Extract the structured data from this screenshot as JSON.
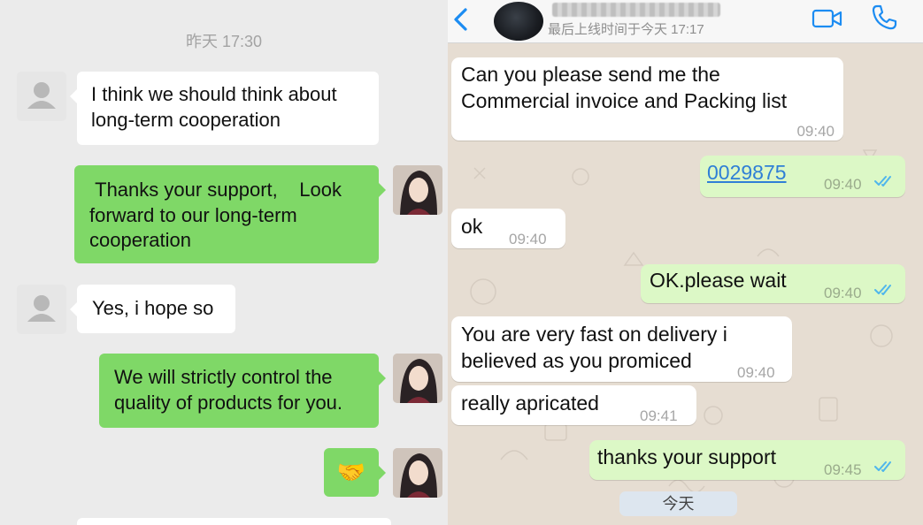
{
  "left_chat": {
    "timestamp": "昨天 17:30",
    "messages": [
      {
        "side": "incoming",
        "text": "I think we should think about\nlong-term cooperation"
      },
      {
        "side": "outgoing",
        "text": " Thanks your support,    Look\nforward to our long-term\ncooperation"
      },
      {
        "side": "incoming",
        "text": "Yes, i hope so"
      },
      {
        "side": "outgoing",
        "text": "We will strictly control the\nquality of products for you."
      },
      {
        "side": "outgoing",
        "text": "🤝",
        "kind": "emoji"
      }
    ],
    "colors": {
      "background": "#ebebeb",
      "outgoing_bubble": "#7fd867",
      "incoming_bubble": "#ffffff"
    }
  },
  "right_chat": {
    "header": {
      "back_icon": "chevron-left-icon",
      "status": "最后上线时间于今天 17:17",
      "video_icon": "video-camera-icon",
      "phone_icon": "phone-icon"
    },
    "messages": [
      {
        "side": "incoming",
        "lines": [
          "Can you please send me the",
          "Commercial invoice and Packing list"
        ],
        "time": "09:40"
      },
      {
        "side": "outgoing",
        "text": "0029875",
        "is_link": true,
        "time": "09:40",
        "read": true
      },
      {
        "side": "incoming",
        "text": "ok",
        "time": "09:40"
      },
      {
        "side": "outgoing",
        "text": "OK.please wait",
        "time": "09:40",
        "read": true
      },
      {
        "side": "incoming",
        "lines": [
          "You are very fast on delivery i",
          "believed as you promiced"
        ],
        "time": "09:40"
      },
      {
        "side": "incoming",
        "text": "really apricated",
        "time": "09:41"
      },
      {
        "side": "outgoing",
        "text": "thanks your support",
        "time": "09:45",
        "read": true
      }
    ],
    "day_separator": "今天",
    "colors": {
      "background": "#e6ddd2",
      "outgoing_bubble": "#dcf8c6",
      "incoming_bubble": "#ffffff",
      "accent": "#1c8cf2",
      "read_ticks": "#4fb6ec"
    }
  }
}
